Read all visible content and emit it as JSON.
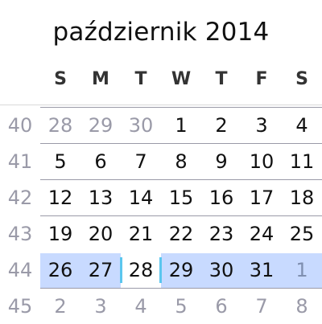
{
  "calendar": {
    "month_title": "październik 2014",
    "weekdays": [
      "S",
      "M",
      "T",
      "W",
      "T",
      "F",
      "S"
    ],
    "weeks": [
      {
        "week": "40",
        "days": [
          {
            "d": "28",
            "other": true
          },
          {
            "d": "29",
            "other": true
          },
          {
            "d": "30",
            "other": true
          },
          {
            "d": "1",
            "other": false
          },
          {
            "d": "2",
            "other": false
          },
          {
            "d": "3",
            "other": false
          },
          {
            "d": "4",
            "other": false
          }
        ]
      },
      {
        "week": "41",
        "days": [
          {
            "d": "5",
            "other": false
          },
          {
            "d": "6",
            "other": false
          },
          {
            "d": "7",
            "other": false
          },
          {
            "d": "8",
            "other": false
          },
          {
            "d": "9",
            "other": false
          },
          {
            "d": "10",
            "other": false
          },
          {
            "d": "11",
            "other": false
          }
        ]
      },
      {
        "week": "42",
        "days": [
          {
            "d": "12",
            "other": false
          },
          {
            "d": "13",
            "other": false
          },
          {
            "d": "14",
            "other": false
          },
          {
            "d": "15",
            "other": false
          },
          {
            "d": "16",
            "other": false
          },
          {
            "d": "17",
            "other": false
          },
          {
            "d": "18",
            "other": false
          }
        ]
      },
      {
        "week": "43",
        "days": [
          {
            "d": "19",
            "other": false
          },
          {
            "d": "20",
            "other": false
          },
          {
            "d": "21",
            "other": false
          },
          {
            "d": "22",
            "other": false
          },
          {
            "d": "23",
            "other": false
          },
          {
            "d": "24",
            "other": false
          },
          {
            "d": "25",
            "other": false
          }
        ]
      },
      {
        "week": "44",
        "selected": true,
        "days": [
          {
            "d": "26",
            "other": false
          },
          {
            "d": "27",
            "other": false
          },
          {
            "d": "28",
            "other": false,
            "today": true
          },
          {
            "d": "29",
            "other": false
          },
          {
            "d": "30",
            "other": false
          },
          {
            "d": "31",
            "other": false
          },
          {
            "d": "1",
            "other": true
          }
        ]
      },
      {
        "week": "45",
        "days": [
          {
            "d": "2",
            "other": true
          },
          {
            "d": "3",
            "other": true
          },
          {
            "d": "4",
            "other": true
          },
          {
            "d": "5",
            "other": true
          },
          {
            "d": "6",
            "other": true
          },
          {
            "d": "7",
            "other": true
          },
          {
            "d": "8",
            "other": true
          }
        ]
      }
    ],
    "colors": {
      "selected_week_band": "#c8daff",
      "today_marker": "#5bc6ee",
      "muted_text": "#9a9aa8"
    }
  }
}
